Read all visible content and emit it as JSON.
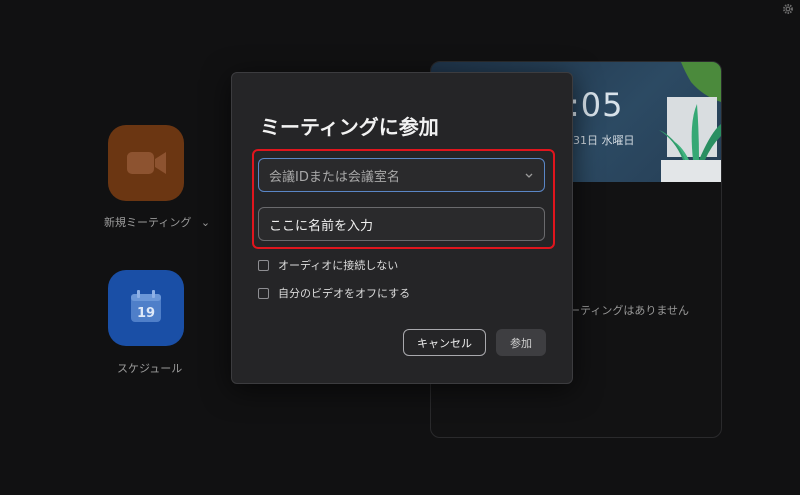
{
  "home": {
    "new_meeting_label": "新規ミーティング",
    "schedule_label": "スケジュール",
    "calendar_day": "19"
  },
  "side_panel": {
    "clock_time": ":05",
    "clock_date": "31日 水曜日",
    "no_meetings_text": "ーティングはありません"
  },
  "dialog": {
    "title": "ミーティングに参加",
    "meeting_id_placeholder": "会議IDまたは会議室名",
    "name_value": "ここに名前を入力",
    "no_audio_label": "オーディオに接続しない",
    "video_off_label": "自分のビデオをオフにする",
    "cancel_label": "キャンセル",
    "join_label": "参加"
  },
  "colors": {
    "highlight": "#e0151d",
    "new_meeting_tile": "#6b3612",
    "schedule_tile": "#1a4fa6",
    "focus_border": "#5a86c6"
  },
  "icons": [
    "gear-icon",
    "video-camera-icon",
    "chevron-down-icon",
    "calendar-icon",
    "plant-illustration"
  ]
}
